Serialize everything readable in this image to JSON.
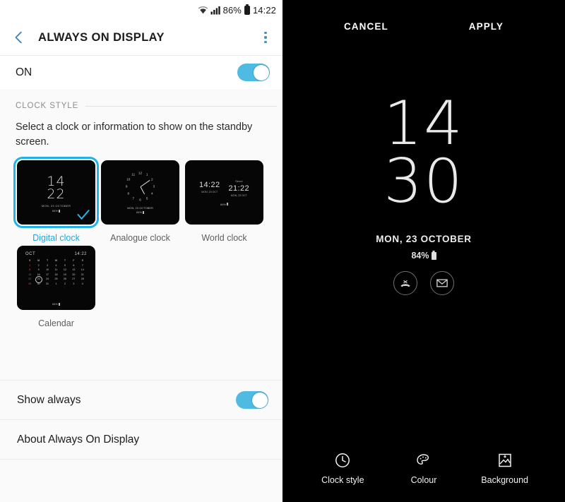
{
  "status_bar": {
    "battery_percent": "86%",
    "time": "14:22",
    "icons": [
      "wifi-icon",
      "signal-icon",
      "battery-icon"
    ]
  },
  "app_bar": {
    "title": "ALWAYS ON DISPLAY",
    "back_icon": "back-chevron-icon",
    "more_icon": "more-options-icon"
  },
  "master_switch": {
    "label": "ON",
    "state": "on"
  },
  "clock_style": {
    "section_title": "CLOCK STYLE",
    "description": "Select a clock or information to show on the standby screen.",
    "options": [
      {
        "label": "Digital clock",
        "selected": true,
        "preview": {
          "hours": "14",
          "minutes": "22",
          "date": "MON, 23 OCTOBER",
          "battery": "84%"
        }
      },
      {
        "label": "Analogue clock",
        "selected": false,
        "preview": {
          "numerals": [
            "12",
            "1",
            "2",
            "3",
            "4",
            "5",
            "6",
            "7",
            "8",
            "9",
            "10",
            "11"
          ],
          "date": "MON, 23 OCTOBER",
          "battery": "84%"
        }
      },
      {
        "label": "World clock",
        "selected": false,
        "preview": {
          "home_city": "",
          "home_time": "14:22",
          "home_date": "MON, 23 OCT",
          "away_city": "Seoul",
          "away_time": "21:22",
          "away_date": "MON, 23 OCT",
          "battery": "84%"
        }
      },
      {
        "label": "Calendar",
        "selected": false,
        "preview": {
          "month": "OCT",
          "time": "14:22",
          "weekdays": [
            "S",
            "M",
            "T",
            "W",
            "T",
            "F",
            "S"
          ],
          "weeks": [
            [
              "1",
              "2",
              "3",
              "4",
              "5",
              "6",
              "7"
            ],
            [
              "8",
              "9",
              "10",
              "11",
              "12",
              "13",
              "14"
            ],
            [
              "15",
              "16",
              "17",
              "18",
              "19",
              "20",
              "21"
            ],
            [
              "22",
              "23",
              "24",
              "25",
              "26",
              "27",
              "28"
            ],
            [
              "29",
              "30",
              "31",
              "1",
              "2",
              "3",
              "4"
            ]
          ],
          "today": "23",
          "battery": "84%"
        }
      }
    ]
  },
  "settings_rows": [
    {
      "label": "Show always",
      "has_toggle": true,
      "state": "on"
    },
    {
      "label": "About Always On Display",
      "has_toggle": false
    }
  ],
  "preview_panel": {
    "cancel_label": "CANCEL",
    "apply_label": "APPLY",
    "clock": {
      "hours": "14",
      "minutes": "30",
      "date": "MON, 23 OCTOBER",
      "battery": "84%"
    },
    "notifications": [
      {
        "icon": "missed-call-icon"
      },
      {
        "icon": "message-envelope-icon"
      }
    ],
    "tabs": [
      {
        "label": "Clock style",
        "icon": "clock-icon"
      },
      {
        "label": "Colour",
        "icon": "palette-icon"
      },
      {
        "label": "Background",
        "icon": "image-icon"
      }
    ]
  },
  "colors": {
    "accent_blue": "#21b2ec",
    "toggle_on": "#4fbbe3",
    "panel_bg": "#fafafa",
    "preview_bg": "#000000"
  }
}
